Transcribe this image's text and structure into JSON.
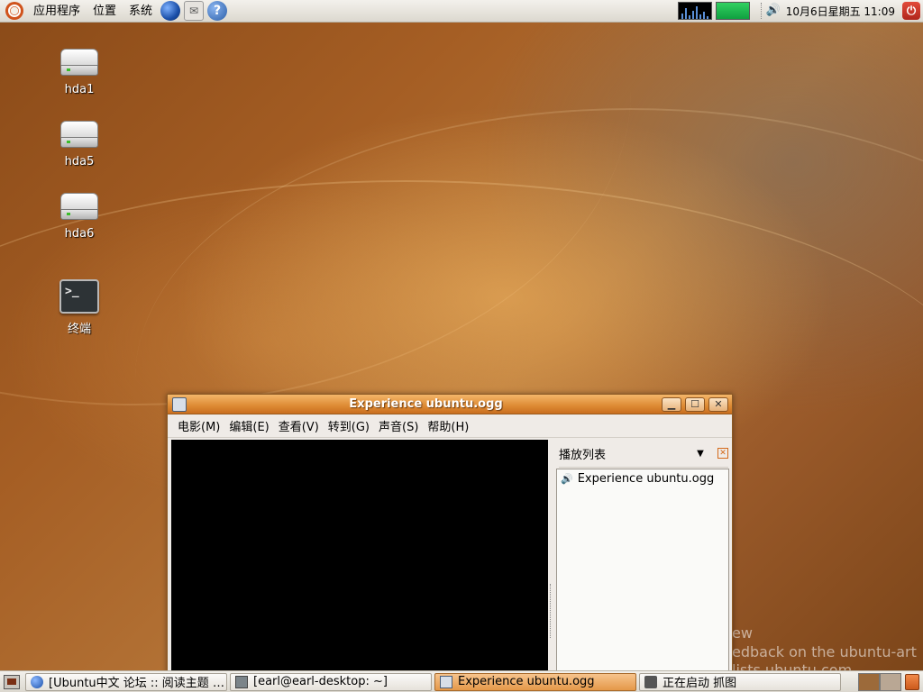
{
  "top_panel": {
    "menus": [
      "应用程序",
      "位置",
      "系统"
    ],
    "launchers": [
      "globe-icon",
      "mail-icon",
      "help-icon"
    ],
    "clock": "10月6日星期五 11:09"
  },
  "desktop_icons": [
    {
      "label": "hda1",
      "icon": "drive-icon"
    },
    {
      "label": "hda5",
      "icon": "drive-icon"
    },
    {
      "label": "hda6",
      "icon": "drive-icon"
    },
    {
      "label": "终端",
      "icon": "terminal-icon",
      "glyph": ">_"
    }
  ],
  "window": {
    "title": "Experience ubuntu.ogg",
    "menus": [
      "电影(M)",
      "编辑(E)",
      "查看(V)",
      "转到(G)",
      "声音(S)",
      "帮助(H)"
    ],
    "playlist": {
      "title": "播放列表",
      "items": [
        "Experience ubuntu.ogg"
      ]
    }
  },
  "wallpaper_text": [
    "ew",
    "edback on the ubuntu-art",
    "lists.ubuntu.com"
  ],
  "taskbar": {
    "tasks": [
      {
        "label": "[Ubuntu中文 论坛 :: 阅读主题 …",
        "icon": "browser-icon",
        "active": false
      },
      {
        "label": "[earl@earl-desktop: ~]",
        "icon": "terminal-icon",
        "active": false
      },
      {
        "label": "Experience ubuntu.ogg",
        "icon": "totem-icon",
        "active": true
      },
      {
        "label": "正在启动 抓图",
        "icon": "camera-icon",
        "active": false
      }
    ]
  },
  "colors": {
    "title_bar": "#dd8a33",
    "active_task": "#e59849",
    "panel": "#e8e5df"
  }
}
